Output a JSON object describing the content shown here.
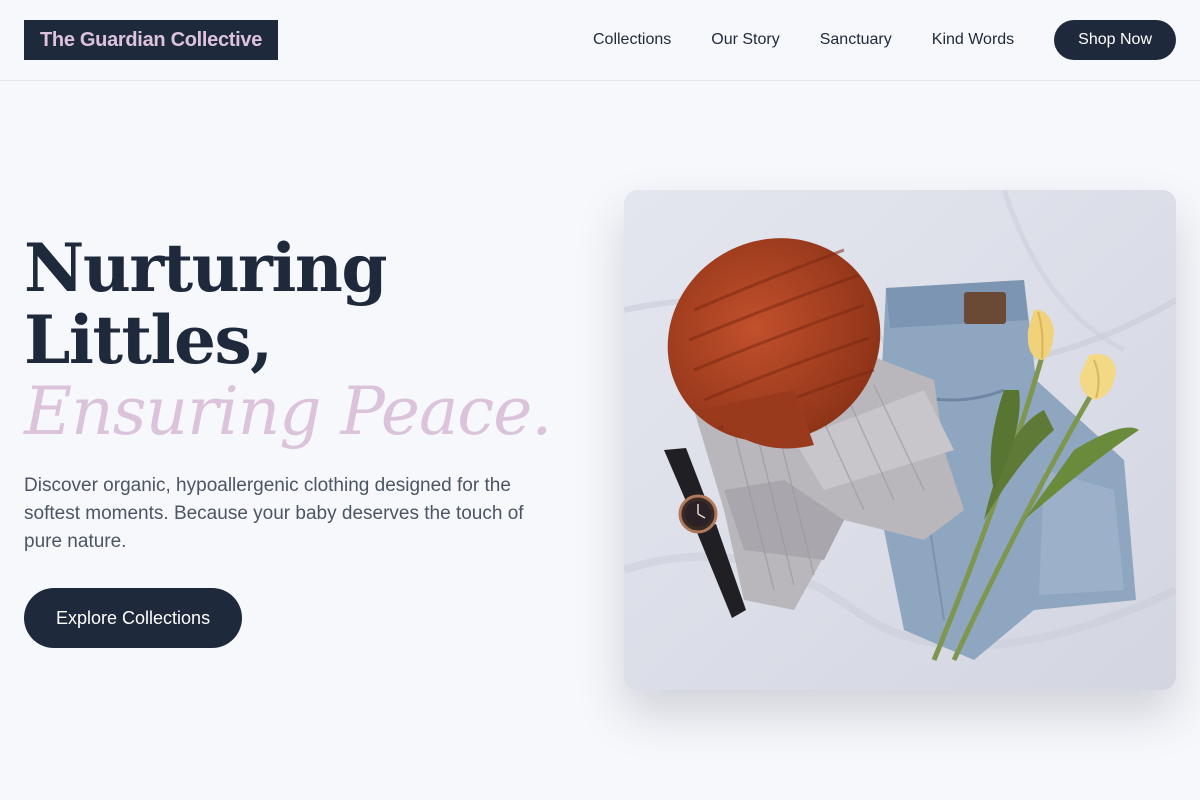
{
  "brand": {
    "name": "The Guardian Collective"
  },
  "nav": {
    "links": [
      "Collections",
      "Our Story",
      "Sanctuary",
      "Kind Words"
    ],
    "cta_label": "Shop Now"
  },
  "hero": {
    "headline_line1": "Nurturing",
    "headline_line2": "Littles,",
    "headline_accent": "Ensuring Peace.",
    "subtext": "Discover organic, hypoallergenic clothing designed for the softest moments. Because your baby deserves the touch of pure nature.",
    "cta_label": "Explore Collections",
    "image_subject": "flat-lay: orange knit beanie, grey ribbed sweater, jeans, wristwatch, yellow tulips"
  },
  "colors": {
    "navy": "#1e293b",
    "lilac_accent": "#dcc3dc",
    "background": "#f7f8fc",
    "body_text": "#4b5563"
  }
}
